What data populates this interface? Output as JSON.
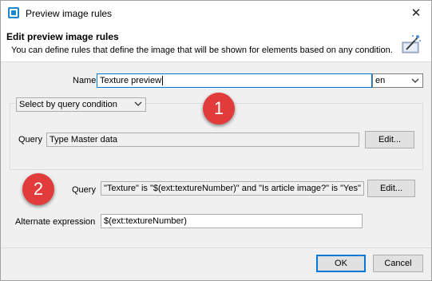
{
  "window": {
    "title": "Preview image rules",
    "close_glyph": "✕"
  },
  "header": {
    "title": "Edit preview image rules",
    "subtitle": "You can define rules that define the image that will be shown for elements based on any condition."
  },
  "form": {
    "name_label": "Name",
    "name_value": "Texture preview",
    "language_value": "en",
    "selector_value": "Select by query condition",
    "query_label_1": "Query",
    "query_value_1": "Type Master data",
    "edit_label_1": "Edit...",
    "query_label_2": "Query",
    "query_value_2": "\"Texture\" is \"$(ext:textureNumber)\" and \"Is article image?\" is \"Yes\"",
    "edit_label_2": "Edit...",
    "alt_label": "Alternate expression",
    "alt_value": "$(ext:textureNumber)"
  },
  "badges": {
    "one": "1",
    "two": "2"
  },
  "buttons": {
    "ok": "OK",
    "cancel": "Cancel"
  },
  "colors": {
    "badge": "#e23b3b",
    "focus": "#0078d7"
  },
  "icons": {
    "app": "app-icon",
    "header": "wand-icon"
  }
}
